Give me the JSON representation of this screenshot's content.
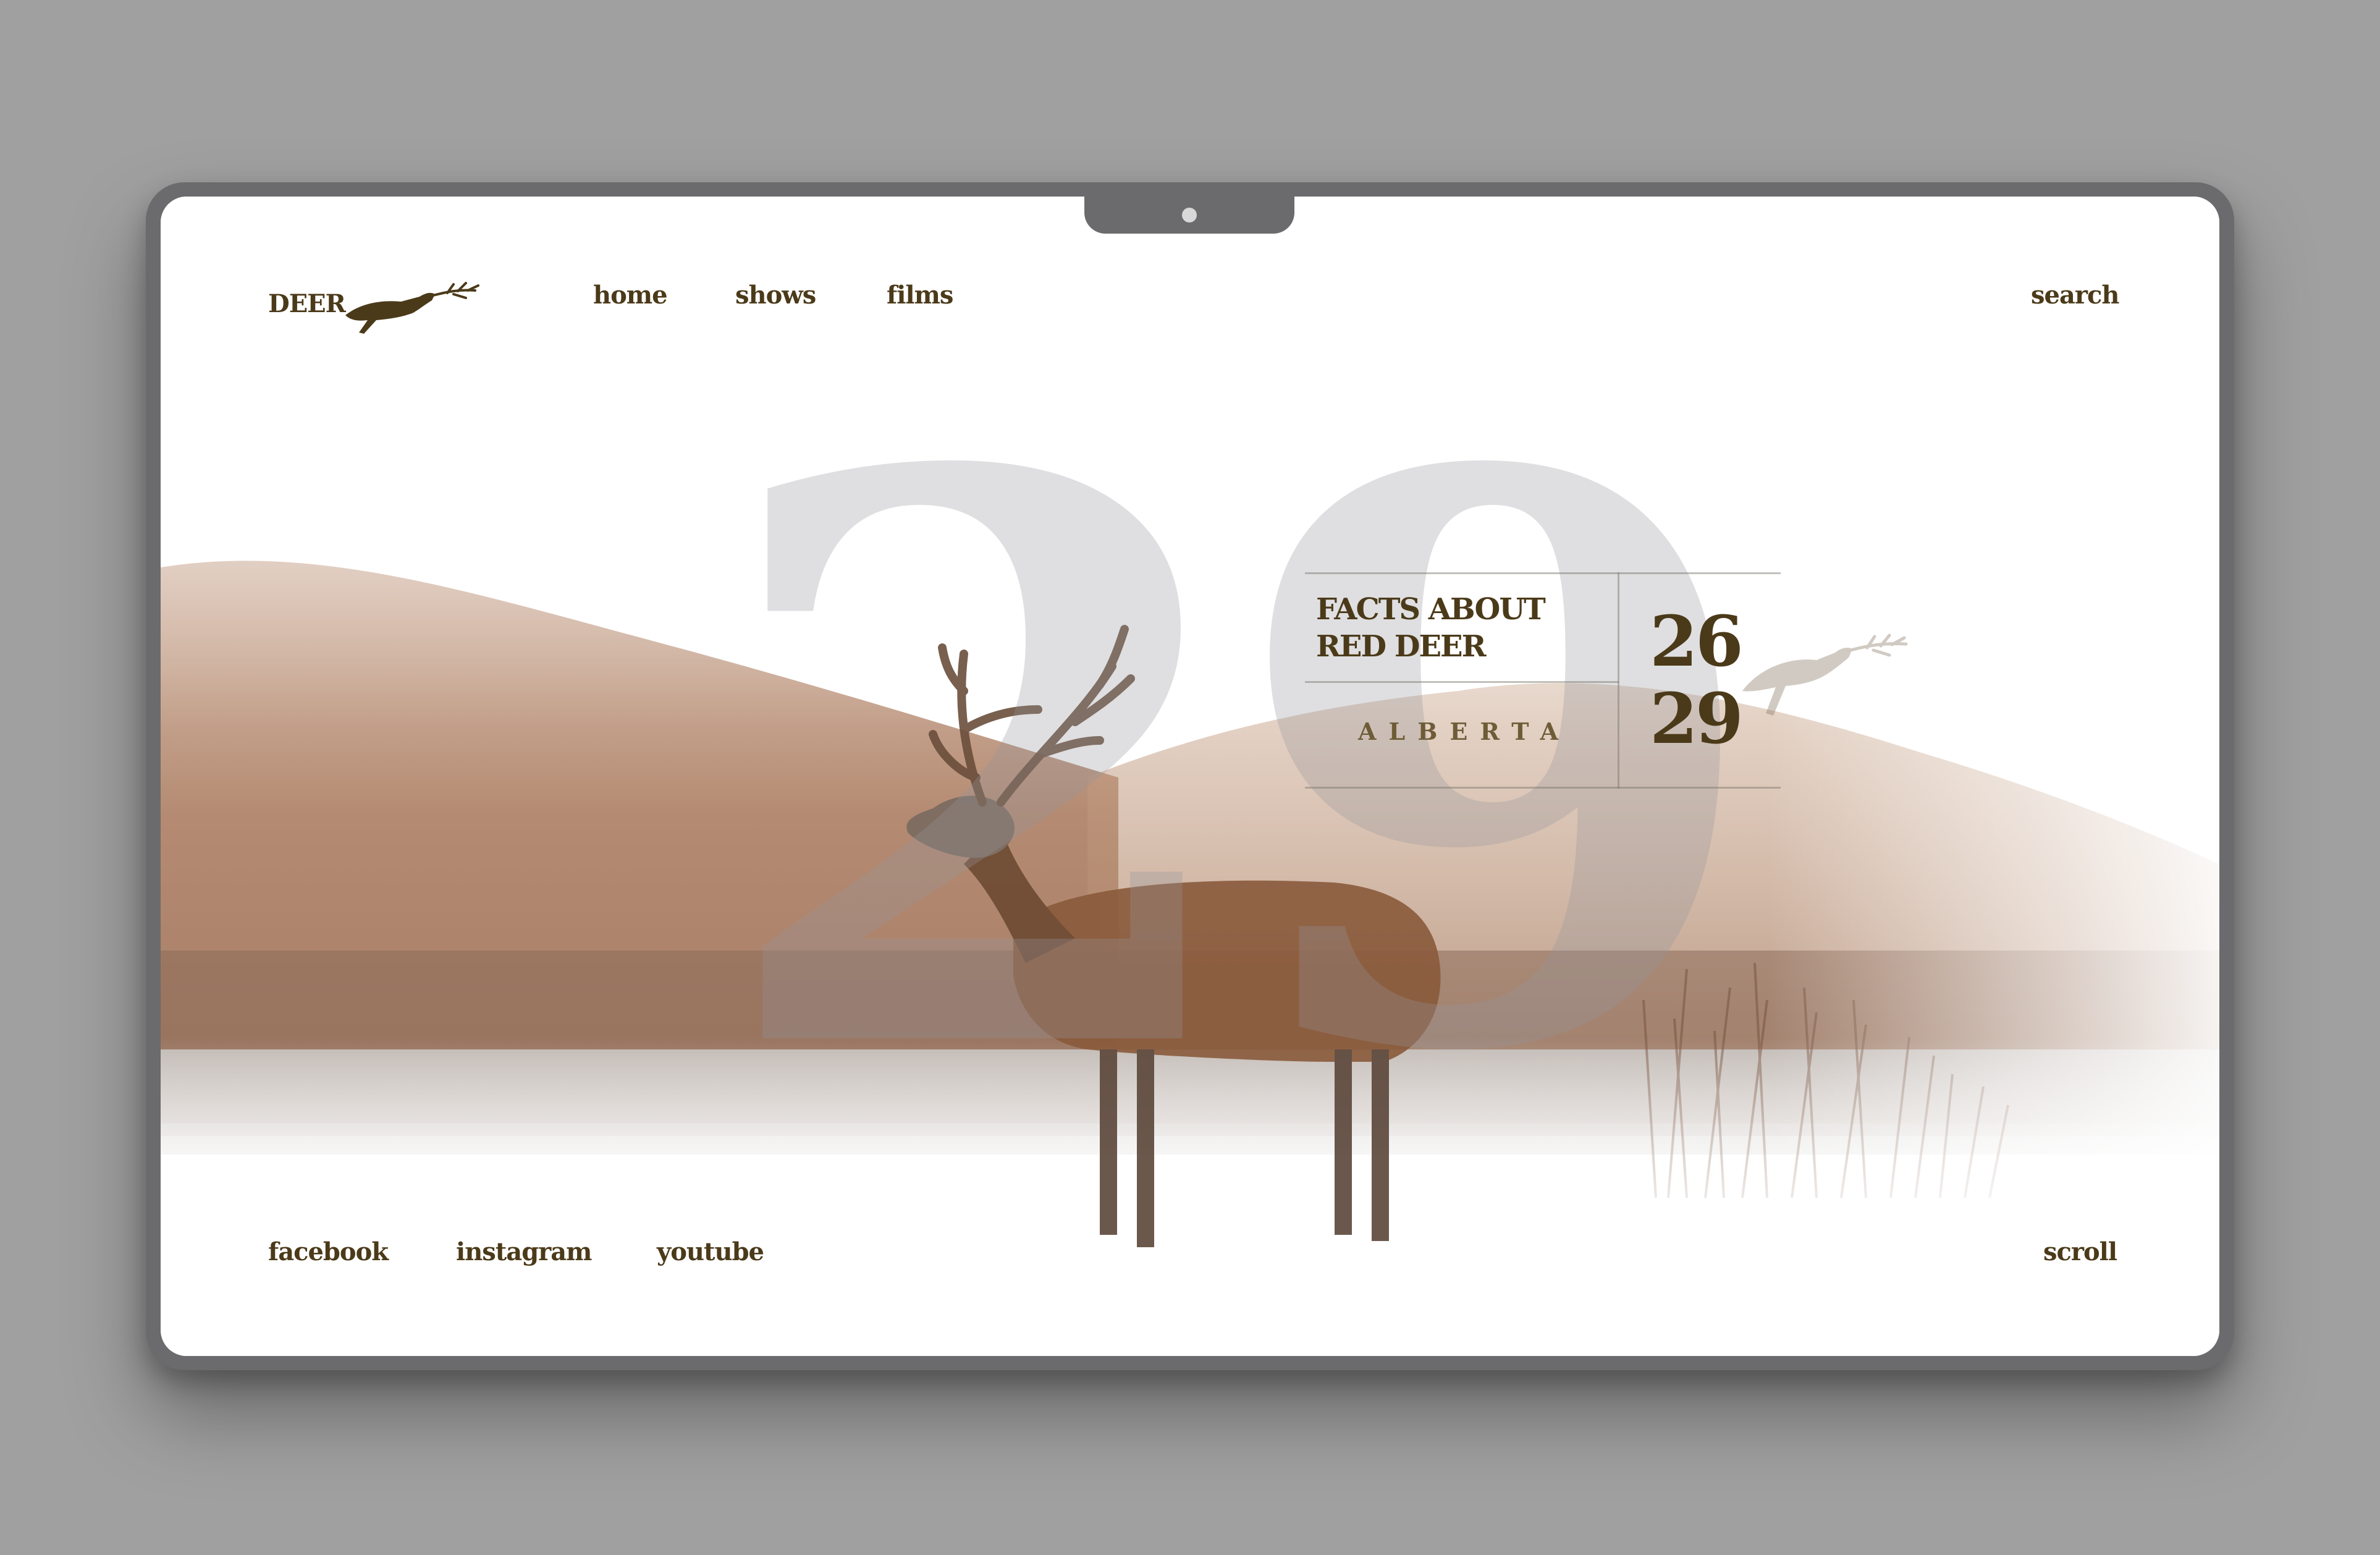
{
  "brand": {
    "name": "DEER",
    "logo_icon": "leaping-deer-logo"
  },
  "nav": {
    "items": [
      "home",
      "shows",
      "films"
    ],
    "search_label": "search"
  },
  "hero": {
    "big_number": "29",
    "facts_title": "FACTS ABOUT RED DEER",
    "location": "ALBERTA",
    "numbers": [
      "26",
      "29"
    ]
  },
  "footer": {
    "social": [
      "facebook",
      "instagram",
      "youtube"
    ],
    "scroll_label": "scroll"
  },
  "colors": {
    "accent": "#4b3a19",
    "device_frame": "#6b6b6d",
    "background": "#a0a0a0"
  }
}
